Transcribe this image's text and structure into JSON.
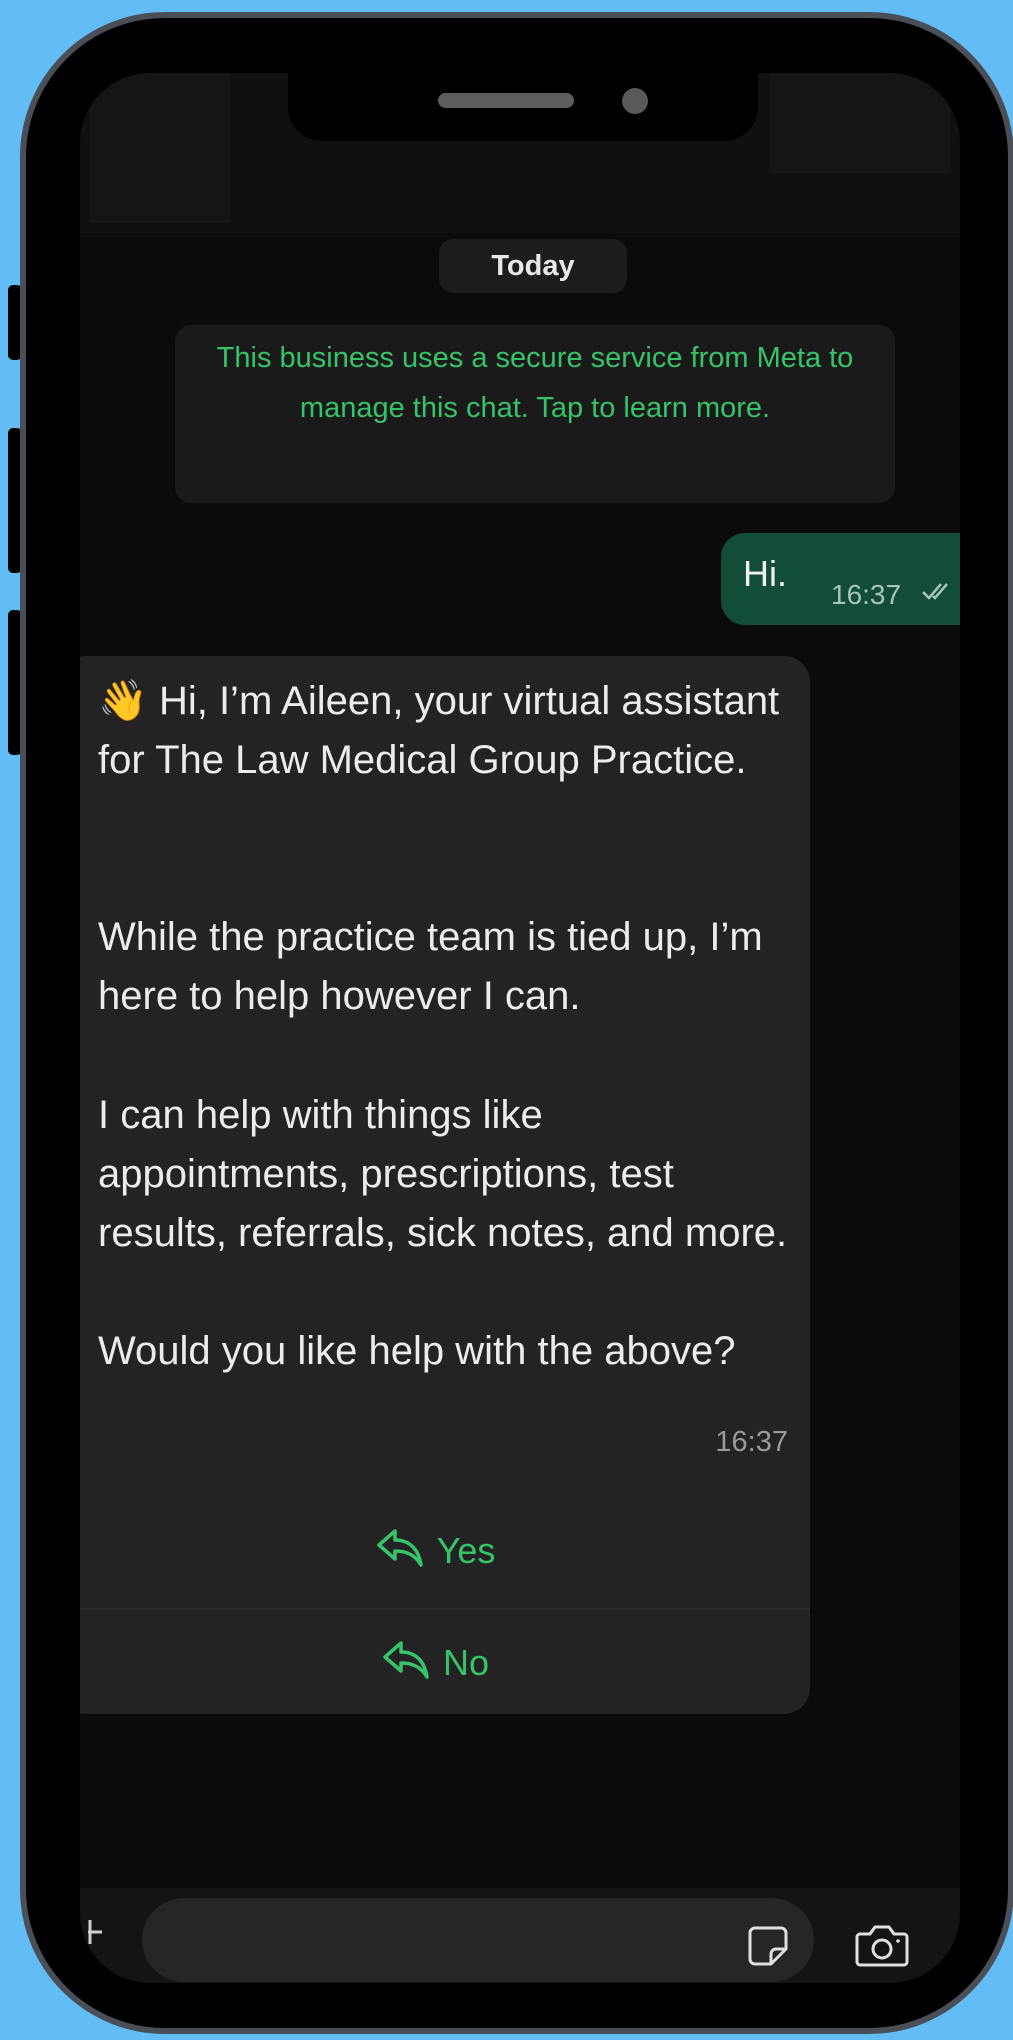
{
  "chat": {
    "date_label": "Today",
    "system_notice": "This business uses a secure service from Meta to manage this chat. Tap to learn more.",
    "outgoing": {
      "text": "Hi.",
      "time": "16:37",
      "status_icon": "double-check-icon"
    },
    "incoming": {
      "emoji": "👋",
      "paragraphs": [
        "Hi, I’m Aileen, your virtual assistant for The Law Medical Group Practice.",
        "While the practice team is tied up, I’m here to help however I can.",
        "I can help with things like appointments, prescriptions, test results, referrals, sick notes, and more.",
        "Would you like help with the above?"
      ],
      "time": "16:37",
      "quick_replies": [
        {
          "label": "Yes",
          "icon": "reply-arrow-icon"
        },
        {
          "label": "No",
          "icon": "reply-arrow-icon"
        }
      ]
    }
  },
  "composer": {
    "input_value": "",
    "icons": [
      "plus-icon",
      "sticker-icon",
      "camera-icon"
    ]
  },
  "colors": {
    "background": "#63bdf5",
    "accent_green": "#35c468",
    "outgoing_bubble": "#114d37",
    "incoming_bubble": "#232323"
  }
}
